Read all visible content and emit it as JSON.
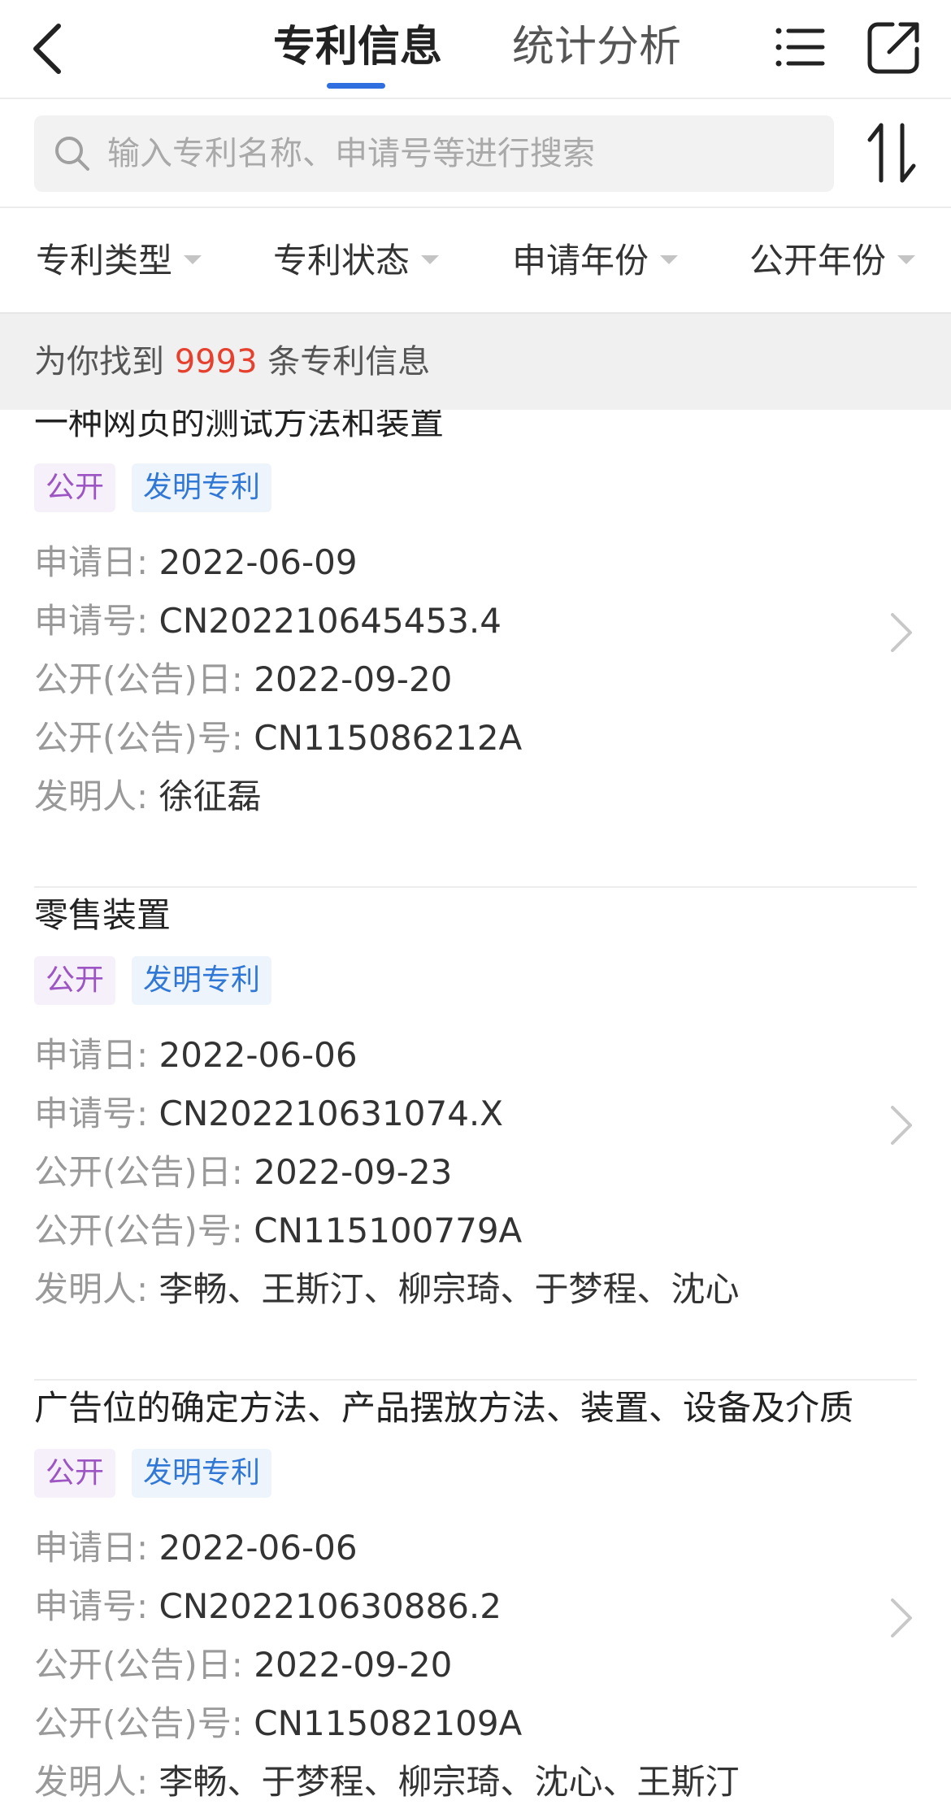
{
  "header": {
    "tabs": [
      {
        "label": "专利信息",
        "active": true
      },
      {
        "label": "统计分析",
        "active": false
      }
    ]
  },
  "search": {
    "placeholder": "输入专利名称、申请号等进行搜索",
    "value": ""
  },
  "filters": [
    {
      "label": "专利类型"
    },
    {
      "label": "专利状态"
    },
    {
      "label": "申请年份"
    },
    {
      "label": "公开年份"
    }
  ],
  "result": {
    "prefix": "为你找到",
    "count": "9993",
    "suffix": "条专利信息"
  },
  "labels": {
    "apply_date": "申请日:",
    "apply_no": "申请号:",
    "pub_date": "公开(公告)日:",
    "pub_no": "公开(公告)号:",
    "inventor": "发明人:"
  },
  "patents": [
    {
      "title": "一种网页的测试方法和装置",
      "status": "公开",
      "type": "发明专利",
      "apply_date": "2022-06-09",
      "apply_no": "CN202210645453.4",
      "pub_date": "2022-09-20",
      "pub_no": "CN115086212A",
      "inventor": "徐征磊"
    },
    {
      "title": "零售装置",
      "status": "公开",
      "type": "发明专利",
      "apply_date": "2022-06-06",
      "apply_no": "CN202210631074.X",
      "pub_date": "2022-09-23",
      "pub_no": "CN115100779A",
      "inventor": "李畅、王斯汀、柳宗琦、于梦程、沈心"
    },
    {
      "title": "广告位的确定方法、产品摆放方法、装置、设备及介质",
      "status": "公开",
      "type": "发明专利",
      "apply_date": "2022-06-06",
      "apply_no": "CN202210630886.2",
      "pub_date": "2022-09-20",
      "pub_no": "CN115082109A",
      "inventor": "李畅、于梦程、柳宗琦、沈心、王斯汀"
    }
  ],
  "colors": {
    "accent": "#2f6fe0",
    "count_highlight": "#e5412e",
    "tag_status_text": "#9c55c2",
    "tag_type_text": "#3178d6"
  },
  "icons": [
    "back-arrow-icon",
    "list-icon",
    "share-icon",
    "search-icon",
    "sort-icon",
    "chevron-right-icon",
    "caret-down-icon"
  ]
}
